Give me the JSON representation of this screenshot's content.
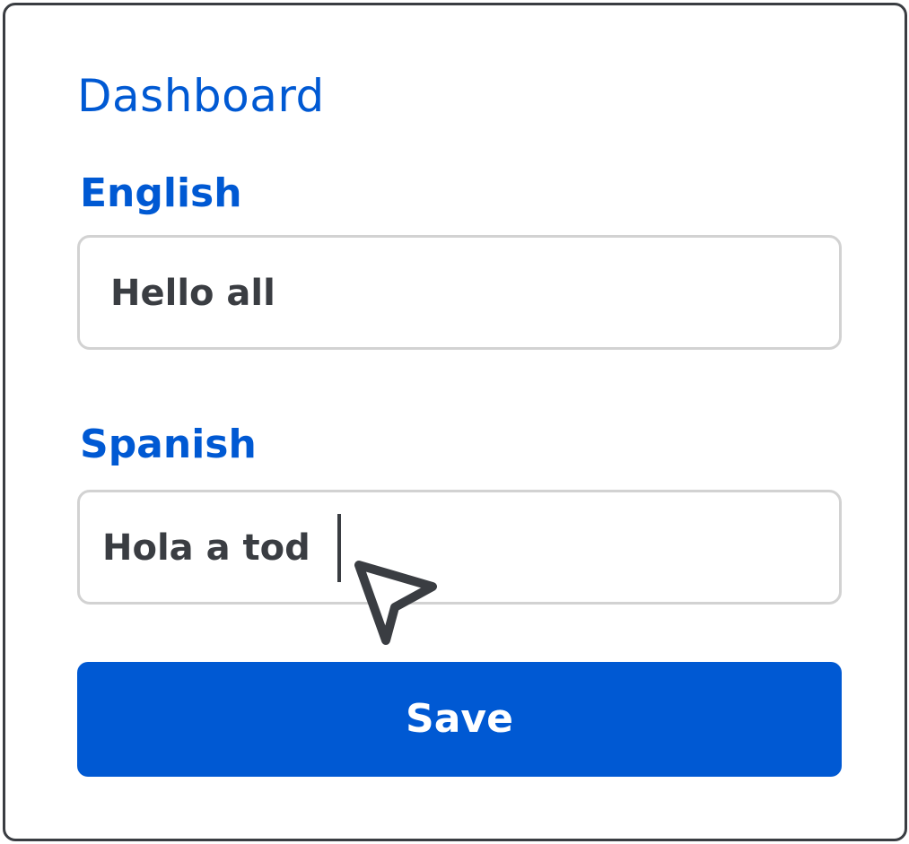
{
  "page": {
    "title": "Dashboard"
  },
  "form": {
    "english": {
      "label": "English",
      "value": "Hello all"
    },
    "spanish": {
      "label": "Spanish",
      "value": "Hola a tod"
    },
    "save_label": "Save"
  },
  "icons": {
    "pointer": "mouse-pointer-icon",
    "caret": "text-caret"
  },
  "colors": {
    "accent": "#0059d3",
    "text": "#3a3d42",
    "field_border": "#d2d2d2",
    "card_border": "#3a3d42"
  }
}
